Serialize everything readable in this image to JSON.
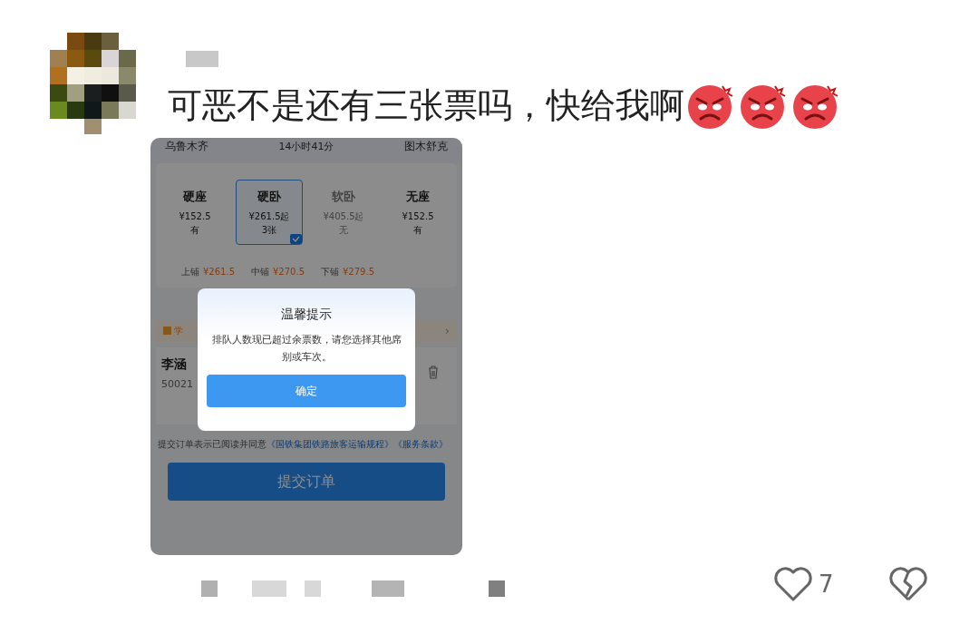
{
  "comment": {
    "text": "可恶不是还有三张票吗，快给我啊",
    "emojis": [
      {
        "kind": "angry"
      },
      {
        "kind": "angry"
      },
      {
        "kind": "angry"
      }
    ]
  },
  "screenshot": {
    "route": {
      "from": "乌鲁木齐",
      "duration": "14小时41分",
      "to": "图木舒克"
    },
    "seats": [
      {
        "name": "硬座",
        "price": "¥152.5",
        "availability": "有",
        "selected": false,
        "disabled": false
      },
      {
        "name": "硬卧",
        "price": "¥261.5起",
        "availability": "3张",
        "selected": true,
        "disabled": false
      },
      {
        "name": "软卧",
        "price": "¥405.5起",
        "availability": "无",
        "selected": false,
        "disabled": true
      },
      {
        "name": "无座",
        "price": "¥152.5",
        "availability": "有",
        "selected": false,
        "disabled": false
      }
    ],
    "berths": [
      {
        "label": "上铺",
        "price": "¥261.5"
      },
      {
        "label": "中铺",
        "price": "¥270.5"
      },
      {
        "label": "下铺",
        "price": "¥279.5"
      }
    ],
    "discount_row": {
      "label": "学",
      "chevron": "›"
    },
    "passenger": {
      "name": "李涵",
      "id": "50021"
    },
    "agreement": {
      "text": "提交订单表示已阅读并同意",
      "links": [
        "《国铁集团铁路旅客运输规程》",
        "《服务条款》"
      ]
    },
    "submit_button": "提交订单",
    "dialog": {
      "title": "温馨提示",
      "message": "排队人数现已超过余票数，请您选择其他席别或车次。",
      "button": "确定"
    }
  },
  "footer": {
    "likes": "7"
  }
}
